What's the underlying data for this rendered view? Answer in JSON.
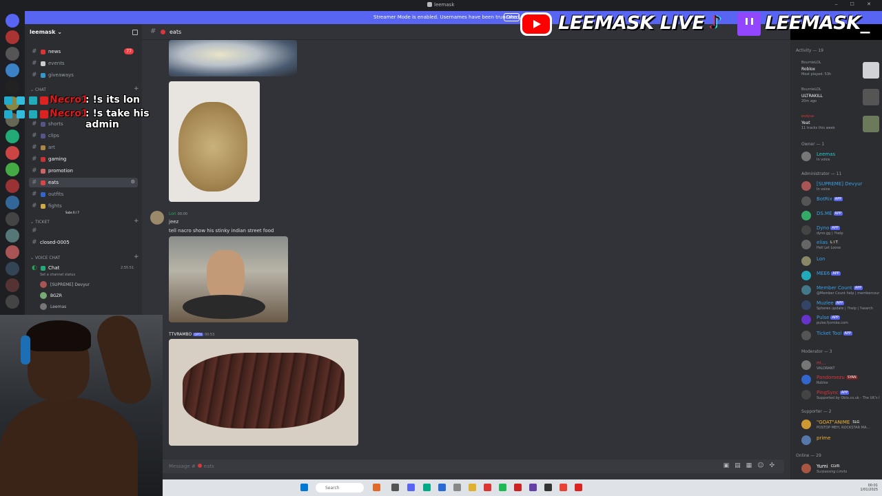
{
  "window": {
    "title": "leemask",
    "banner_text": "Streamer Mode is enabled. Usernames have been truncated.",
    "banner_button": "Disa"
  },
  "server": {
    "name": "leemask"
  },
  "channels": {
    "news": "news",
    "news_badge": "77",
    "events": "events",
    "giveaways": "giveaways",
    "cat_chat": "Chat",
    "shorts": "shorts",
    "clips": "clips",
    "art": "art",
    "gaming": "gaming",
    "promotion": "promotion",
    "eats": "eats",
    "outfits": "outfits",
    "fights": "fights",
    "fights_sub": "Subs 0 / 7",
    "cat_ticket": "Ticket",
    "closed": "closed-0005",
    "cat_voice": "Voice Chat",
    "voice_chat": "Chat",
    "voice_timer": "2:55:51",
    "voice_status": "Set a channel status",
    "voice_users": [
      "[SUPREME] Devyur",
      "BGZR",
      "Leemas"
    ]
  },
  "chat": {
    "channel": "eats",
    "msg1_author": "Lon",
    "msg1_time": "00:00",
    "msg1_line1": "jeez",
    "msg1_line2": "tell nacro show his stinky indian street food",
    "msg2_author": "TTVRAMBO",
    "msg2_tag": "OPTX",
    "msg2_time": "00:53",
    "composer_placeholder": "Message #",
    "composer_channel": "eats"
  },
  "members": {
    "activity_header": "Activity — 19",
    "act1_user": "BournieLOL",
    "act1_game": "Roblox",
    "act1_sub": "Most played: 53h",
    "act2_user": "BournieLOL",
    "act2_game": "ULTRAKILL",
    "act2_sub": "20m ago",
    "act3_user": "esdyua",
    "act3_game": "Yeat",
    "act3_sub": "11 tracks this week",
    "owner_header": "Owner — 1",
    "owner": "Leemas",
    "owner_sub": "In voice",
    "admin_header": "Administrator — 11",
    "admins": [
      "[SUPREME] Devyur",
      "BotRix",
      "DS.ME",
      "Dyno",
      "elias",
      "Lon",
      "MEE6",
      "Member Count",
      "Muzlee",
      "Pulse",
      "Ticket Tool"
    ],
    "admin_subs": [
      "In voice",
      "",
      "",
      "dyno.gg | ?help",
      "Hell Let Loose",
      "",
      "",
      "@Member Count help | membercour",
      "Spheres update | ?help | ?search",
      "pulse.fyxmbo.com",
      ""
    ],
    "mod_header": "Moderator — 3",
    "mods": [
      "m...",
      "Pandoroezu",
      "PingSync"
    ],
    "mod_subs": [
      "VALORANT",
      "Roblox",
      "Supported by Oblo.co.uk - The UK's I"
    ],
    "supporter_header": "Supporter — 2",
    "supporters": [
      "\"GOAT\"ANIME",
      "prime"
    ],
    "supporter_subs": [
      "POSTOP MEH, ROCKSTAR MA...",
      ""
    ],
    "online_header": "Online — 29",
    "online": [
      "Yumi",
      ""
    ],
    "online_subs": [
      "Surpassing Limits"
    ],
    "app_tag": "APP",
    "status_tags": [
      "SYAN",
      "SLG",
      "CLVR",
      "L I T"
    ]
  },
  "overlay": {
    "brand1": "LEEMASK LIVE",
    "brand2": "LEEMASK_",
    "chat_lines": [
      {
        "user": "Necro1",
        "text": ": !s its lon"
      },
      {
        "user": "Necro1",
        "text": ": !s take his admin"
      }
    ]
  },
  "taskbar": {
    "search": "Search",
    "time": "00:01",
    "date": "1/01/2025"
  },
  "colors": {
    "blurple": "#5865f2",
    "background": "#313338",
    "sidebar": "#2b2d31",
    "green": "#23a55a"
  }
}
